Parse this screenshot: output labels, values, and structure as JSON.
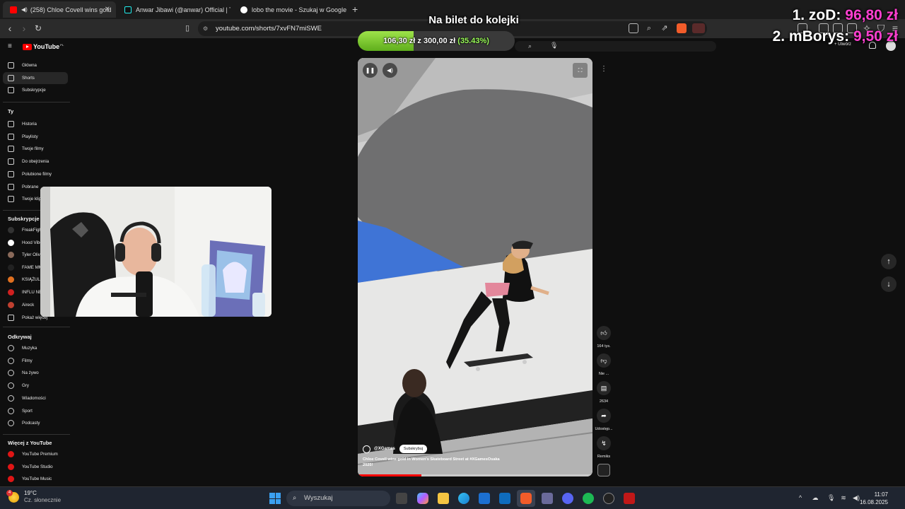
{
  "tabs": [
    {
      "title": "(258) Chloe Covell wins gold",
      "color": "#ff0000"
    },
    {
      "title": "Anwar Jibawi (@anwar) Official | TikTok",
      "color": "#111111"
    },
    {
      "title": "lobo the movie - Szukaj w Google",
      "color": "#ffffff"
    }
  ],
  "address": {
    "url": "youtube.com/shorts/7xvFN7miSWE"
  },
  "overlay": {
    "goal_title": "Na bilet do kolejki",
    "goal_current": "106,30 zł",
    "goal_sep": "z",
    "goal_target": "300,00 zł",
    "goal_percent": "(35.43%)",
    "goal_fraction": 0.3543,
    "rank1_name": "1. zoD:",
    "rank1_amount": "96,80 zł",
    "rank2_name": "2. mBorys:",
    "rank2_amount": "9,50 zł"
  },
  "header": {
    "create_label": "Utwórz"
  },
  "sidebar": {
    "logo": "YouTube",
    "logo_region": "PL",
    "main": [
      {
        "label": "Główna",
        "icon": "home-icon"
      },
      {
        "label": "Shorts",
        "icon": "shorts-icon"
      },
      {
        "label": "Subskrypcje",
        "icon": "subscriptions-icon"
      }
    ],
    "you_header": "Ty",
    "you": [
      {
        "label": "Historia",
        "icon": "history-icon"
      },
      {
        "label": "Playlisty",
        "icon": "playlists-icon"
      },
      {
        "label": "Twoje filmy",
        "icon": "your-videos-icon"
      },
      {
        "label": "Do obejrzenia",
        "icon": "watch-later-icon"
      },
      {
        "label": "Polubione filmy",
        "icon": "liked-icon"
      },
      {
        "label": "Pobrane",
        "icon": "downloads-icon"
      },
      {
        "label": "Twoje klipy",
        "icon": "clips-icon"
      }
    ],
    "subs_header": "Subskrypcje",
    "subs": [
      {
        "label": "FreakFight",
        "color": "#333333"
      },
      {
        "label": "Hood Vibes",
        "color": "#ffffff"
      },
      {
        "label": "Tyler Oliveira",
        "color": "#8a6a5a"
      },
      {
        "label": "FAME MMA",
        "color": "#222222"
      },
      {
        "label": "KSIĄŻULO",
        "color": "#e07020"
      },
      {
        "label": "INFLU NEWS",
        "color": "#d02020"
      },
      {
        "label": "Aireck",
        "color": "#c04030"
      }
    ],
    "show_more": "Pokaż więcej",
    "explore_header": "Odkrywaj",
    "explore": [
      {
        "label": "Muzyka",
        "icon": "music-icon"
      },
      {
        "label": "Filmy",
        "icon": "movies-icon"
      },
      {
        "label": "Na żywo",
        "icon": "live-icon"
      },
      {
        "label": "Gry",
        "icon": "gaming-icon"
      },
      {
        "label": "Wiadomości",
        "icon": "news-icon"
      },
      {
        "label": "Sport",
        "icon": "sport-icon"
      },
      {
        "label": "Podcasty",
        "icon": "podcasts-icon"
      }
    ],
    "more_header": "Więcej z YouTube",
    "more": [
      {
        "label": "YouTube Premium"
      },
      {
        "label": "YouTube Studio"
      },
      {
        "label": "YouTube Music"
      }
    ]
  },
  "video": {
    "channel": "@XGames",
    "subscribe": "Subskrybuj",
    "title": "Chloe Covell wins gold in Women's Skateboard Street at",
    "hashtag": "#XGamesOsaka",
    "title_end": "2025!",
    "progress_fraction": 0.27
  },
  "actions": {
    "likes": "164 tys.",
    "dislike": "Nie ...",
    "comments": "2634",
    "share": "Udostęp...",
    "remix": "Remiks"
  },
  "taskbar": {
    "temperature": "19°C",
    "weather": "Cz. słonecznie",
    "weather_badge": "4",
    "search_placeholder": "Wyszukaj",
    "time": "11:07",
    "date": "16.08.2025"
  }
}
